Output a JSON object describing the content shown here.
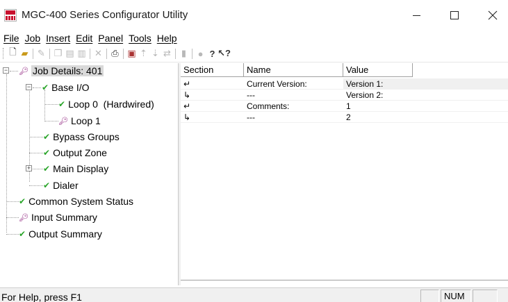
{
  "window": {
    "title": "MGC-400 Series Configurator Utility",
    "icon": "mgc-400-app-icon",
    "controls": [
      "minimize-icon",
      "maximize-icon",
      "close-icon"
    ]
  },
  "menu": {
    "items": [
      "File",
      "Job",
      "Insert",
      "Edit",
      "Panel",
      "Tools",
      "Help"
    ]
  },
  "toolbar": {
    "icons": [
      "new-document-icon",
      "open-folder-icon",
      "edit-pencil-icon",
      "copy-icon",
      "paste-icon",
      "paste-special-icon",
      "delete-icon",
      "print-icon",
      "properties-icon",
      "upload-icon",
      "download-icon",
      "transfer-icon",
      "stop-icon",
      "flag-icon",
      "help-icon",
      "context-help-icon"
    ]
  },
  "tree": {
    "items": [
      {
        "label": "Job Details: 401",
        "icon": "key-icon",
        "selected": true
      },
      {
        "label": "Base I/O",
        "icon": "check-icon"
      },
      {
        "label": "Loop 0  (Hardwired)",
        "icon": "check-icon"
      },
      {
        "label": "Loop 1",
        "icon": "key-icon"
      },
      {
        "label": "Bypass Groups",
        "icon": "check-icon"
      },
      {
        "label": "Output Zone",
        "icon": "check-icon"
      },
      {
        "label": "Main Display",
        "icon": "check-icon"
      },
      {
        "label": "Dialer",
        "icon": "check-icon"
      },
      {
        "label": "Common System Status",
        "icon": "check-icon"
      },
      {
        "label": "Input Summary",
        "icon": "key-icon"
      },
      {
        "label": "Output Summary",
        "icon": "check-icon"
      }
    ]
  },
  "grid": {
    "columns": [
      "Section",
      "Name",
      "Value"
    ],
    "rows": [
      {
        "section": "↵",
        "name": "Current Version:",
        "value": "Version 1:"
      },
      {
        "section": "↳",
        "name": "---",
        "value": "Version 2:"
      },
      {
        "section": "↵",
        "name": "Comments:",
        "value": "1"
      },
      {
        "section": "↳",
        "name": "---",
        "value": "2"
      }
    ]
  },
  "status": {
    "help_text": "For Help, press F1",
    "num_indicator": "NUM"
  }
}
